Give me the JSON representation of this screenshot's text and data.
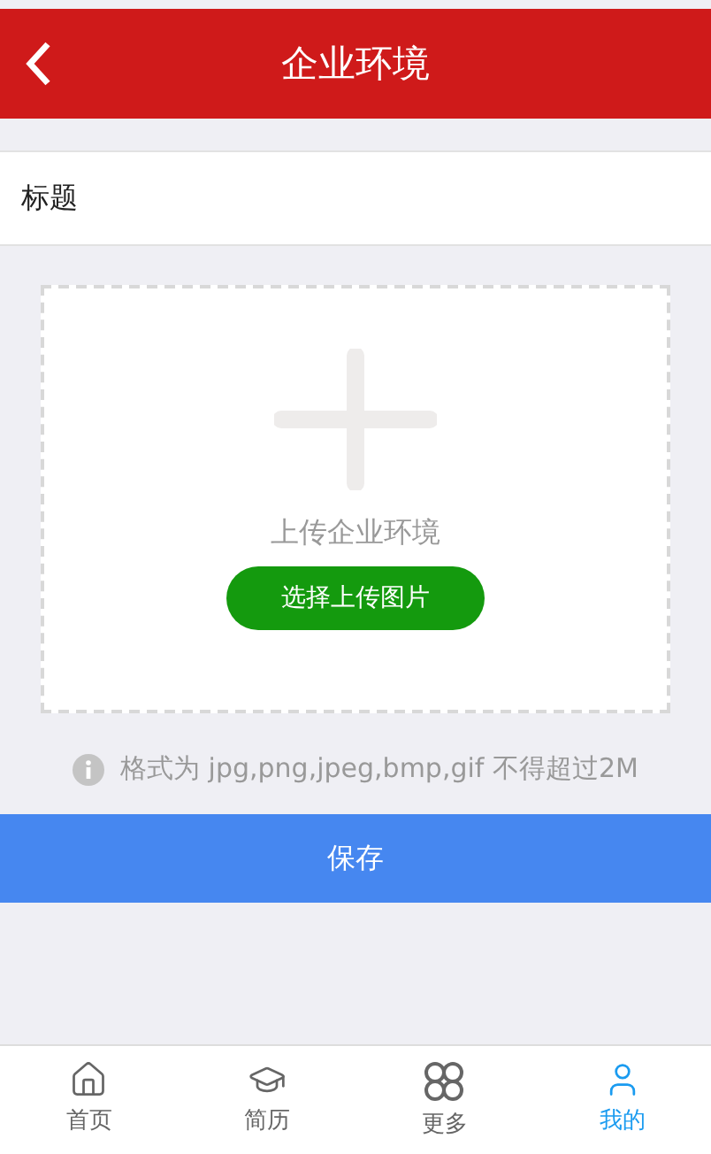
{
  "header": {
    "title": "企业环境"
  },
  "title_field": {
    "label": "标题"
  },
  "upload": {
    "caption": "上传企业环境",
    "button": "选择上传图片"
  },
  "note": "格式为 jpg,png,jpeg,bmp,gif 不得超过2M",
  "save_button": "保存",
  "tabs": [
    {
      "kind": "home",
      "label": "首页",
      "selected": false
    },
    {
      "kind": "resume",
      "label": "简历",
      "selected": false
    },
    {
      "kind": "more",
      "label": "更多",
      "selected": false
    },
    {
      "kind": "me",
      "label": "我的",
      "selected": true
    }
  ]
}
